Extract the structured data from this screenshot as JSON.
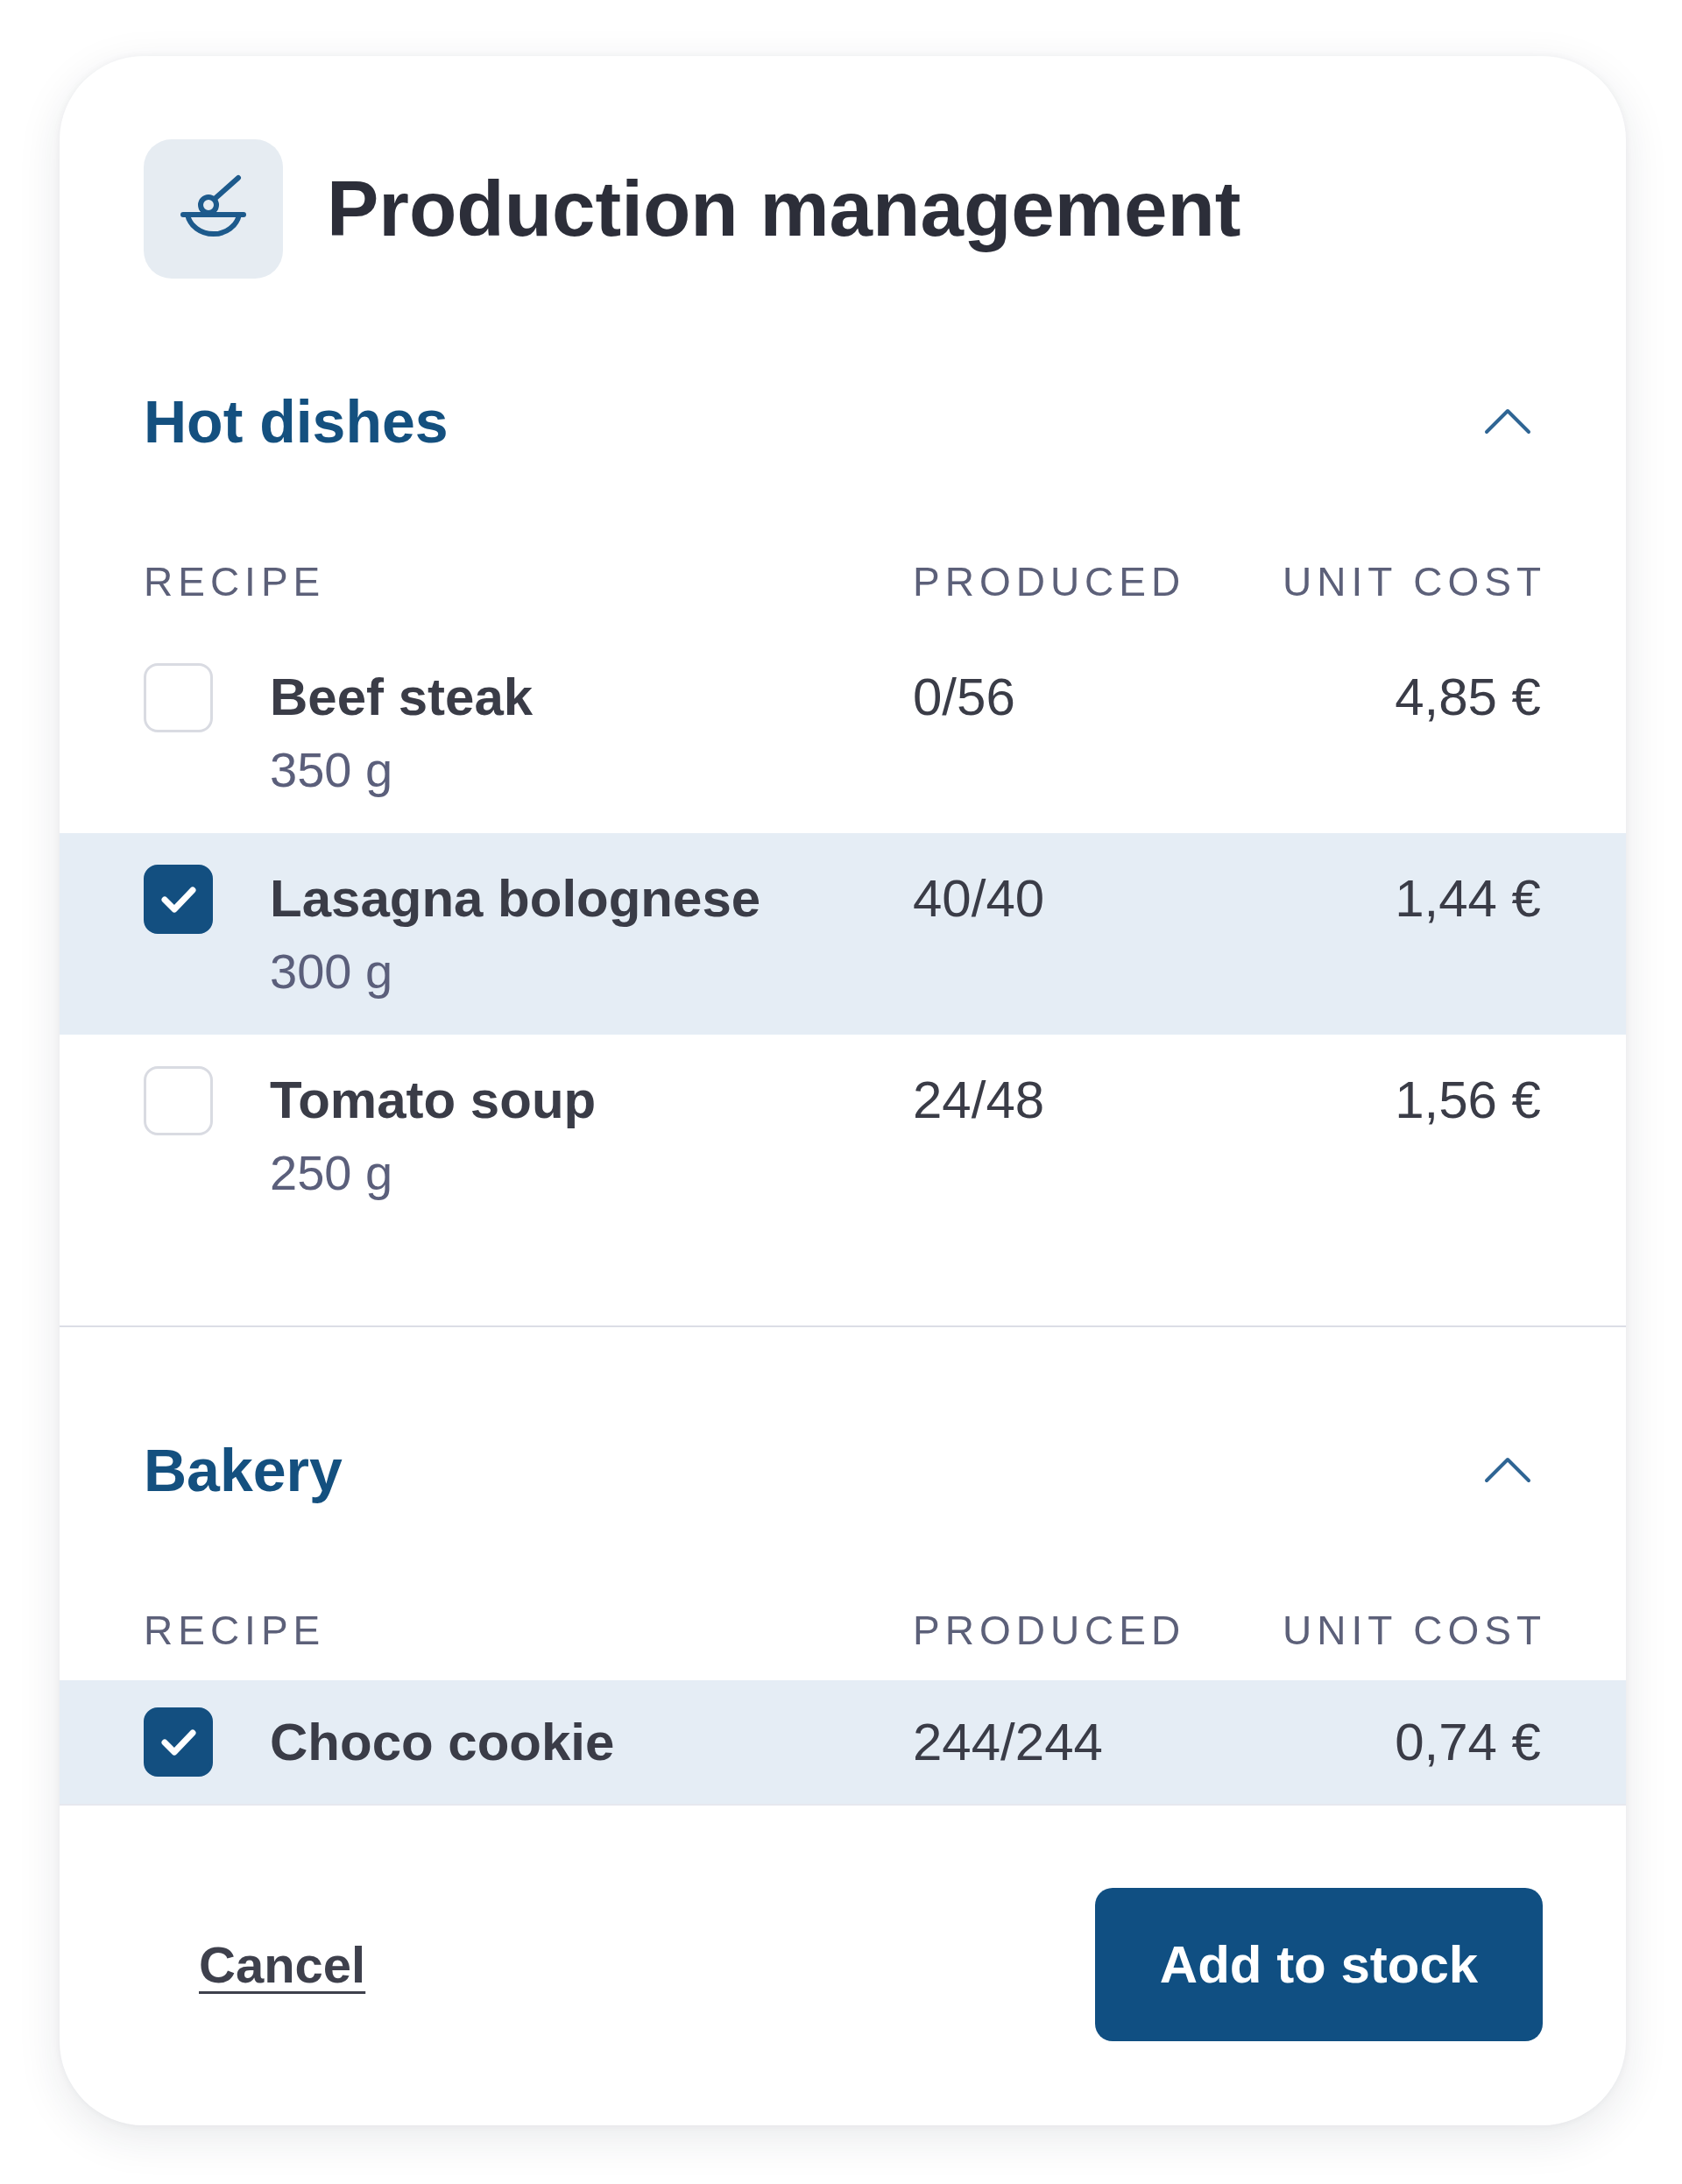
{
  "dialog": {
    "title": "Production management"
  },
  "sections": [
    {
      "title": "Hot dishes",
      "expanded": true,
      "columns": [
        "RECIPE",
        "PRODUCED",
        "UNIT COST"
      ],
      "rows": [
        {
          "name": "Beef steak",
          "weight": "350 g",
          "produced": "0/56",
          "unit_cost": "4,85 €",
          "checked": false
        },
        {
          "name": "Lasagna bolognese",
          "weight": "300 g",
          "produced": "40/40",
          "unit_cost": "1,44 €",
          "checked": true
        },
        {
          "name": "Tomato soup",
          "weight": "250 g",
          "produced": "24/48",
          "unit_cost": "1,56 €",
          "checked": false
        }
      ]
    },
    {
      "title": "Bakery",
      "expanded": true,
      "columns": [
        "RECIPE",
        "PRODUCED",
        "UNIT COST"
      ],
      "rows": [
        {
          "name": "Choco cookie",
          "produced": "244/244",
          "unit_cost": "0,74 €",
          "checked": true
        }
      ]
    }
  ],
  "footer": {
    "cancel": "Cancel",
    "submit": "Add to stock"
  }
}
